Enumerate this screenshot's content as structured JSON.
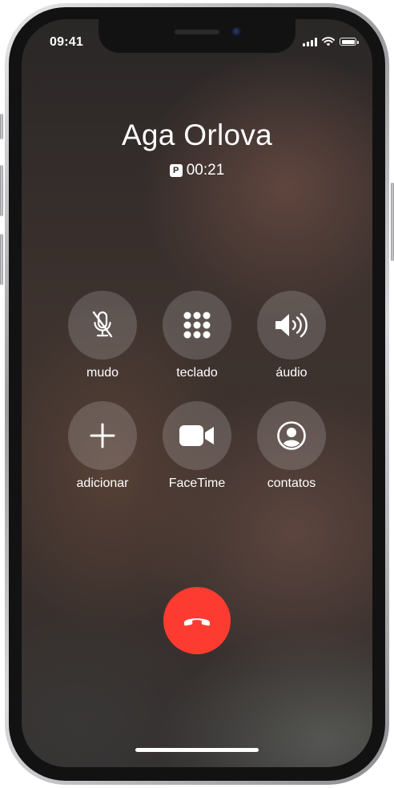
{
  "status_bar": {
    "time": "09:41",
    "signal_icon": "signal-bars-icon",
    "wifi_icon": "wifi-icon",
    "battery_icon": "battery-full-icon"
  },
  "call": {
    "caller_name": "Aga Orlova",
    "badge": "P",
    "duration": "00:21"
  },
  "controls": [
    {
      "label": "mudo",
      "icon": "microphone-slash-icon"
    },
    {
      "label": "teclado",
      "icon": "keypad-icon"
    },
    {
      "label": "áudio",
      "icon": "speaker-icon"
    },
    {
      "label": "adicionar",
      "icon": "plus-icon"
    },
    {
      "label": "FaceTime",
      "icon": "video-camera-icon"
    },
    {
      "label": "contatos",
      "icon": "contact-icon"
    }
  ],
  "end_call": {
    "icon": "phone-hang-up-icon",
    "color": "#fe3b30"
  }
}
